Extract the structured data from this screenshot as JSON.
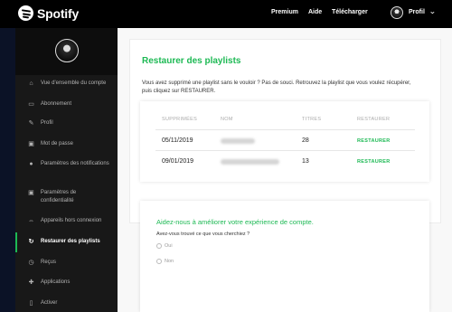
{
  "topbar": {
    "brand": "Spotify",
    "nav": [
      "Premium",
      "Aide",
      "Télécharger"
    ],
    "profile_label": "Profil"
  },
  "sidebar": {
    "items": [
      {
        "label": "Vue d'ensemble du compte",
        "icon": "home-icon"
      },
      {
        "label": "Abonnement",
        "icon": "card-icon"
      },
      {
        "label": "Profil",
        "icon": "pencil-icon"
      },
      {
        "label": "Mot de passe",
        "icon": "lock-icon"
      },
      {
        "label": "Paramètres des notifications",
        "icon": "bell-icon"
      },
      {
        "label": "Paramètres de confidentialité",
        "icon": "lock-icon"
      },
      {
        "label": "Appareils hors connexion",
        "icon": "devices-icon"
      },
      {
        "label": "Restaurer des playlists",
        "icon": "restore-icon",
        "active": true
      },
      {
        "label": "Reçus",
        "icon": "clock-icon"
      },
      {
        "label": "Applications",
        "icon": "puzzle-icon"
      },
      {
        "label": "Activer",
        "icon": "device-icon"
      }
    ]
  },
  "main": {
    "title": "Restaurer des playlists",
    "intro": "Vous avez supprimé une playlist sans le vouloir ? Pas de souci. Retrouvez la playlist que vous voulez récupérer, puis cliquez sur RESTAURER.",
    "table": {
      "headers": [
        "SUPPRIMÉES",
        "NOM",
        "TITRES",
        "RESTAURER"
      ],
      "rows": [
        {
          "date": "05/11/2019",
          "titres": "28",
          "action": "RESTAURER"
        },
        {
          "date": "09/01/2019",
          "titres": "13",
          "action": "RESTAURER"
        }
      ]
    },
    "survey": {
      "title": "Aidez-nous à améliorer votre expérience de compte.",
      "question": "Avez-vous trouvé ce que vous cherchiez ?",
      "options": [
        "Oui",
        "Non"
      ]
    }
  },
  "colors": {
    "accent": "#1db954",
    "topbar_bg": "#000000",
    "sidebar_bg": "#181818"
  }
}
